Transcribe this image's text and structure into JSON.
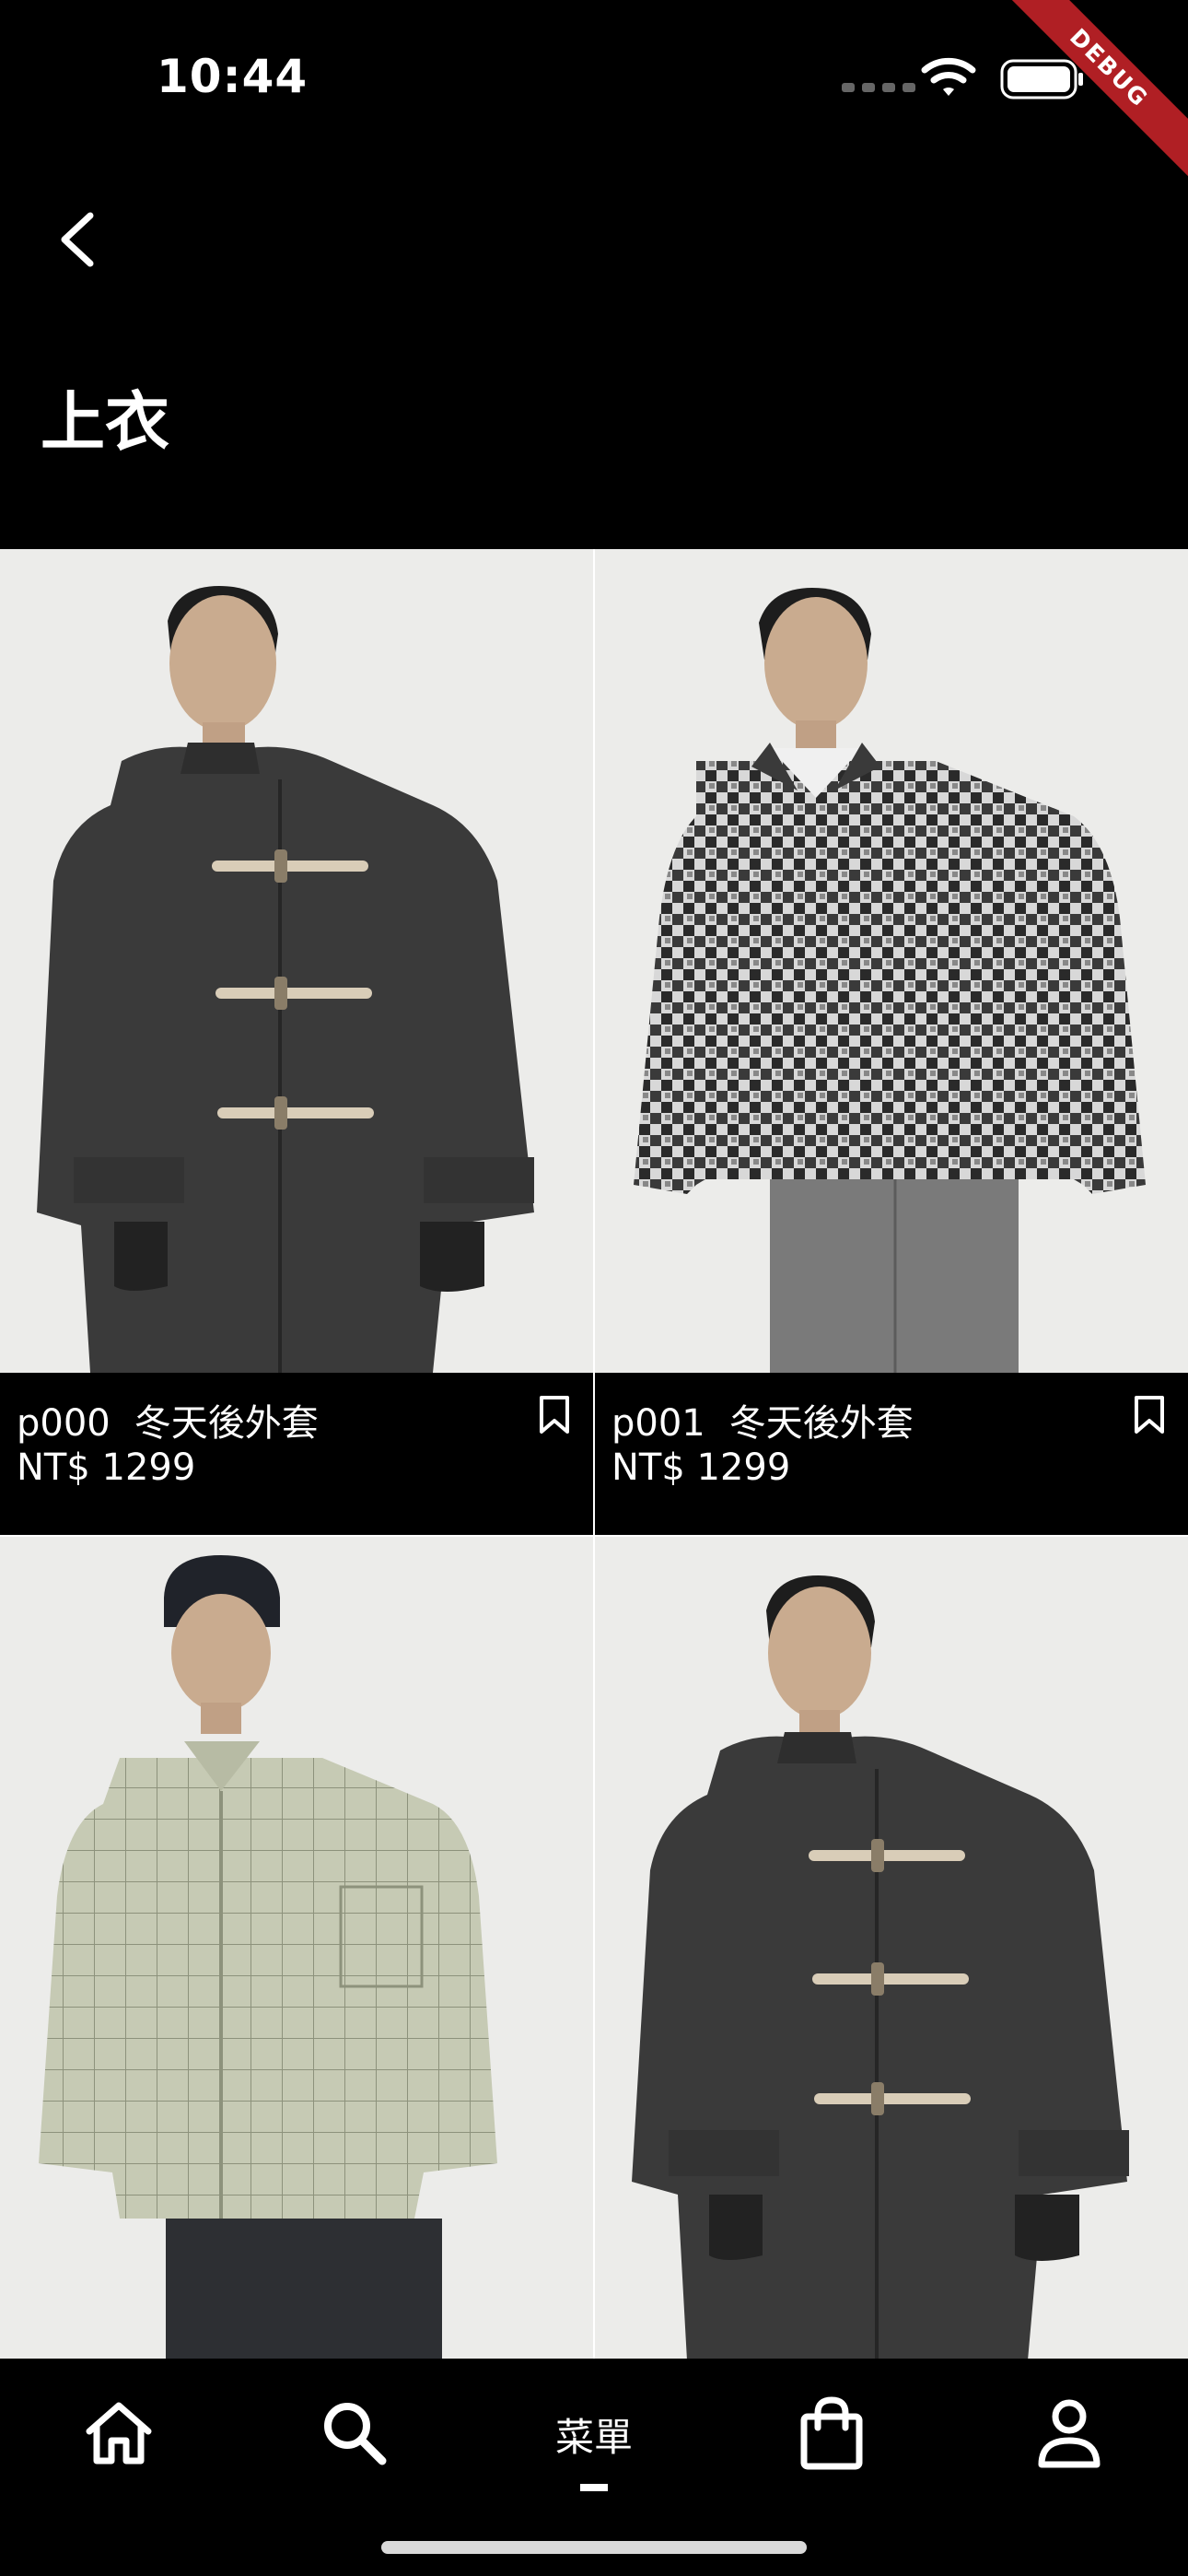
{
  "status_bar": {
    "time": "10:44",
    "debug_label": "DEBUG"
  },
  "app_bar": {
    "back_icon": "chevron-left-icon",
    "title": "上衣"
  },
  "products": [
    {
      "id": "p000",
      "name": "冬天後外套",
      "price": "NT$ 1299",
      "bookmark_icon": "bookmark-icon"
    },
    {
      "id": "p001",
      "name": "冬天後外套",
      "price": "NT$ 1299",
      "bookmark_icon": "bookmark-icon"
    },
    {
      "id": "",
      "name": "",
      "price": "",
      "bookmark_icon": "bookmark-icon"
    },
    {
      "id": "",
      "name": "",
      "price": "",
      "bookmark_icon": "bookmark-icon"
    }
  ],
  "bottom_nav": {
    "items": [
      {
        "icon": "home-icon"
      },
      {
        "icon": "search-icon"
      },
      {
        "label": "菜單",
        "active": true
      },
      {
        "icon": "shopping-bag-icon"
      },
      {
        "icon": "user-icon"
      }
    ]
  },
  "colors": {
    "background": "#000000",
    "text": "#ffffff",
    "debug_ribbon": "#b01f24",
    "image_bg": "#ececea"
  }
}
